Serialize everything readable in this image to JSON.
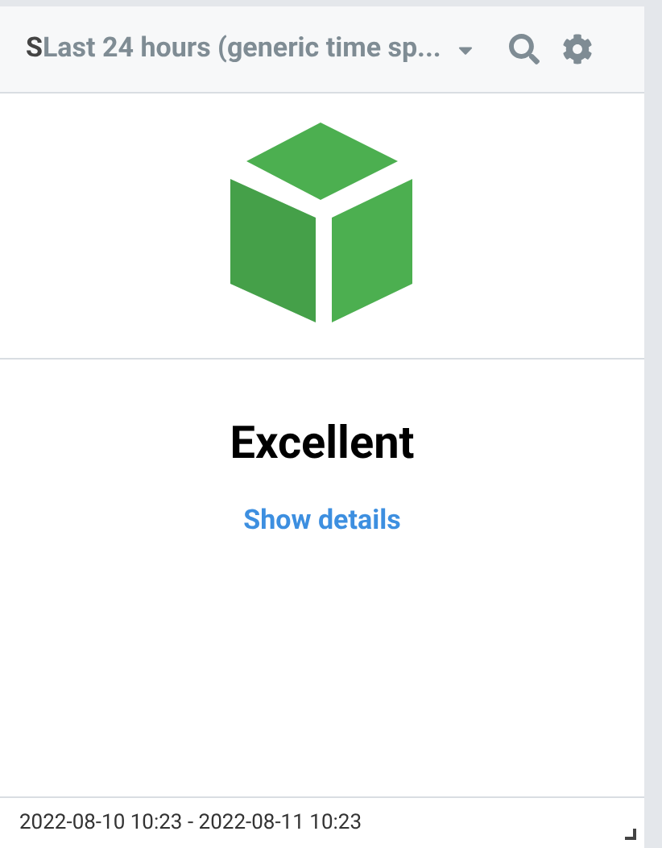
{
  "header": {
    "prefix": "S",
    "title": "Last 24 hours (generic time sp..."
  },
  "status": {
    "label": "Excellent",
    "link": "Show details"
  },
  "footer": {
    "range": "2022-08-10 10:23 - 2022-08-11 10:23"
  }
}
